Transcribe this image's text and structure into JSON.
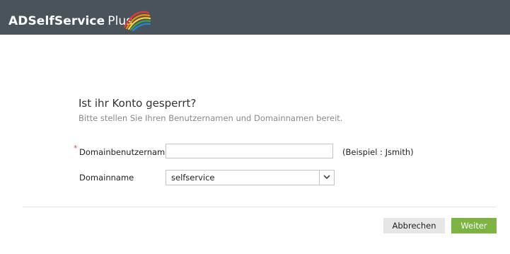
{
  "header": {
    "logo_main": "ADSelfService",
    "logo_plus": "Plus",
    "bar_color": "#4a535b"
  },
  "form": {
    "title": "Ist ihr Konto gesperrt?",
    "subtitle": "Bitte stellen Sie Ihren Benutzernamen und Domainnamen bereit.",
    "required_marker": "*",
    "username_label": "Domainbenutzername",
    "username_value": "",
    "username_placeholder": "",
    "username_hint": "(Beispiel : Jsmith)",
    "domain_label": "Domainname",
    "domain_selected": "selfservice"
  },
  "actions": {
    "cancel_label": "Abbrechen",
    "next_label": "Weiter",
    "next_color": "#7cb342"
  },
  "icons": {
    "logo": "rainbow-swoosh-icon",
    "dropdown": "chevron-down-icon"
  }
}
